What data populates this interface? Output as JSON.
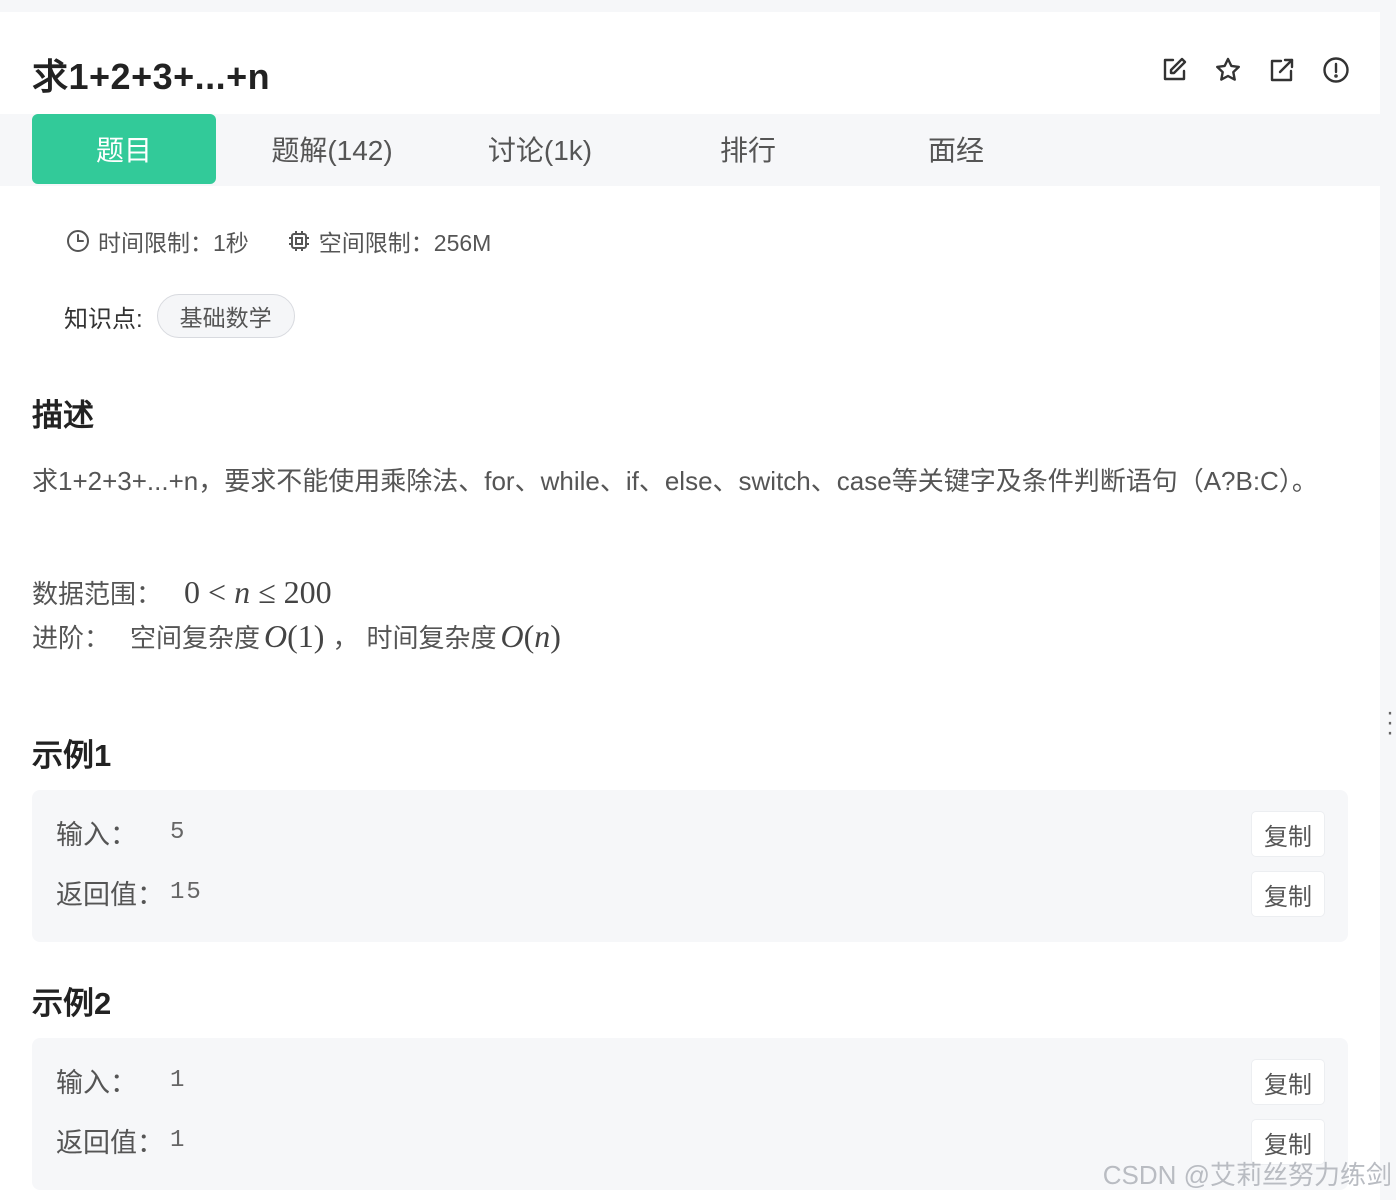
{
  "title": "求1+2+3+...+n",
  "header_icons": [
    "edit-icon",
    "star-icon",
    "external-link-icon",
    "report-icon"
  ],
  "tabs": [
    {
      "label": "题目"
    },
    {
      "label": "题解(142)"
    },
    {
      "label": "讨论(1k)"
    },
    {
      "label": "排行"
    },
    {
      "label": "面经"
    }
  ],
  "limits": {
    "time": "时间限制：1秒",
    "space": "空间限制：256M"
  },
  "knowledge": {
    "label": "知识点:",
    "tag": "基础数学"
  },
  "description": {
    "heading": "描述",
    "text": "求1+2+3+...+n，要求不能使用乘除法、for、while、if、else、switch、case等关键字及条件判断语句（A?B:C）。",
    "range_label": "数据范围：",
    "range_math": "0 < n ≤ 200",
    "advanced_label": "进阶：",
    "space_label": "空间复杂度",
    "space_math": "O(1)",
    "separator": "，",
    "time_label": "时间复杂度",
    "time_math": "O(n)"
  },
  "examples": [
    {
      "heading": "示例1",
      "input_label": "输入：",
      "input": "5",
      "output_label": "返回值：",
      "output": "15",
      "copy_label": "复制"
    },
    {
      "heading": "示例2",
      "input_label": "输入：",
      "input": "1",
      "output_label": "返回值：",
      "output": "1",
      "copy_label": "复制"
    }
  ],
  "watermark": "CSDN @艾莉丝努力练剑",
  "colors": {
    "accent": "#32ca99",
    "panel": "#ffffff",
    "background": "#f6f7f9"
  }
}
